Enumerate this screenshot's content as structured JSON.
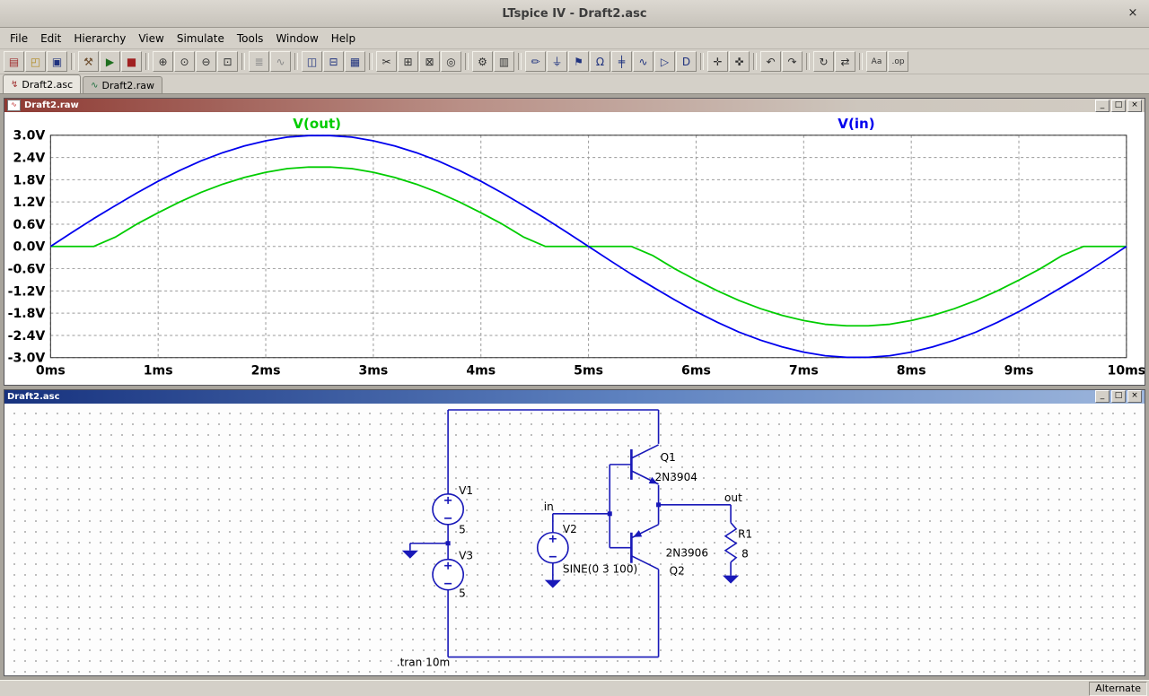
{
  "window": {
    "title": "LTspice IV - Draft2.asc",
    "close_glyph": "×"
  },
  "menu": {
    "items": [
      "File",
      "Edit",
      "Hierarchy",
      "View",
      "Simulate",
      "Tools",
      "Window",
      "Help"
    ]
  },
  "toolbar": {
    "icons": [
      {
        "name": "new-schematic",
        "glyph": "▤",
        "color": "#a03030"
      },
      {
        "name": "open-file",
        "glyph": "◰",
        "color": "#b08a20"
      },
      {
        "name": "save",
        "glyph": "▣",
        "color": "#20337f"
      },
      {
        "sep": true
      },
      {
        "name": "control-panel",
        "glyph": "⚒",
        "color": "#6b4a2a"
      },
      {
        "name": "run-simulation",
        "glyph": "▶",
        "color": "#1f6f1f"
      },
      {
        "name": "halt-simulation",
        "glyph": "■",
        "color": "#a02020"
      },
      {
        "sep": true
      },
      {
        "name": "zoom-in",
        "glyph": "⊕",
        "color": "#303030"
      },
      {
        "name": "zoom-back",
        "glyph": "⊙",
        "color": "#303030"
      },
      {
        "name": "zoom-out",
        "glyph": "⊖",
        "color": "#303030"
      },
      {
        "name": "zoom-full-extents",
        "glyph": "⊡",
        "color": "#303030"
      },
      {
        "sep": true
      },
      {
        "name": "spice-netlist",
        "glyph": "≣",
        "color": "#8a8a8a"
      },
      {
        "name": "visible-traces",
        "glyph": "∿",
        "color": "#8a8a8a"
      },
      {
        "sep": true
      },
      {
        "name": "tile-vertically",
        "glyph": "◫",
        "color": "#20337f"
      },
      {
        "name": "tile-horizontally",
        "glyph": "⊟",
        "color": "#20337f"
      },
      {
        "name": "cascade-windows",
        "glyph": "▦",
        "color": "#20337f"
      },
      {
        "sep": true
      },
      {
        "name": "cut",
        "glyph": "✂",
        "color": "#303030"
      },
      {
        "name": "copy",
        "glyph": "⊞",
        "color": "#303030"
      },
      {
        "name": "paste",
        "glyph": "⊠",
        "color": "#303030"
      },
      {
        "name": "find",
        "glyph": "◎",
        "color": "#303030"
      },
      {
        "sep": true
      },
      {
        "name": "print-setup",
        "glyph": "⚙",
        "color": "#303030"
      },
      {
        "name": "print",
        "glyph": "▥",
        "color": "#303030"
      },
      {
        "sep": true
      },
      {
        "name": "draw-wire",
        "glyph": "✏",
        "color": "#20337f"
      },
      {
        "name": "place-ground",
        "glyph": "⏚",
        "color": "#20337f"
      },
      {
        "name": "place-net-label",
        "glyph": "⚑",
        "color": "#20337f"
      },
      {
        "name": "place-resistor",
        "glyph": "Ω",
        "color": "#20337f"
      },
      {
        "name": "place-capacitor",
        "glyph": "╪",
        "color": "#20337f"
      },
      {
        "name": "place-inductor",
        "glyph": "∿",
        "color": "#20337f"
      },
      {
        "name": "place-diode",
        "glyph": "▷",
        "color": "#20337f"
      },
      {
        "name": "place-component",
        "glyph": "D",
        "color": "#20337f"
      },
      {
        "sep": true
      },
      {
        "name": "move",
        "glyph": "✛",
        "color": "#303030"
      },
      {
        "name": "drag",
        "glyph": "✜",
        "color": "#303030"
      },
      {
        "sep": true
      },
      {
        "name": "undo",
        "glyph": "↶",
        "color": "#303030"
      },
      {
        "name": "redo",
        "glyph": "↷",
        "color": "#303030"
      },
      {
        "sep": true
      },
      {
        "name": "rotate",
        "glyph": "↻",
        "color": "#303030"
      },
      {
        "name": "mirror",
        "glyph": "⇄",
        "color": "#303030"
      },
      {
        "sep": true
      },
      {
        "name": "add-text",
        "glyph": "Aa",
        "color": "#303030"
      },
      {
        "name": "spice-directive",
        "glyph": ".op",
        "color": "#303030"
      }
    ]
  },
  "tabs": [
    {
      "label": "Draft2.asc",
      "icon": "↯",
      "icon_color": "#a03030",
      "active": true
    },
    {
      "label": "Draft2.raw",
      "icon": "∿",
      "icon_color": "#207040",
      "active": false
    }
  ],
  "raw_window": {
    "title": "Draft2.raw",
    "icon": "∿",
    "minimize": "_",
    "maximize": "□",
    "close": "×"
  },
  "asc_window": {
    "title": "Draft2.asc",
    "minimize": "_",
    "maximize": "□",
    "close": "×"
  },
  "chart_data": {
    "type": "line",
    "title": "",
    "xlabel": "",
    "ylabel": "",
    "xlim": [
      0,
      10
    ],
    "ylim": [
      -3,
      3
    ],
    "grid": "dashed",
    "legend_position": "top-inside",
    "x_ticks": [
      "0ms",
      "1ms",
      "2ms",
      "3ms",
      "4ms",
      "5ms",
      "6ms",
      "7ms",
      "8ms",
      "9ms",
      "10ms"
    ],
    "y_ticks": [
      "3.0V",
      "2.4V",
      "1.8V",
      "1.2V",
      "0.6V",
      "0.0V",
      "-0.6V",
      "-1.2V",
      "-1.8V",
      "-2.4V",
      "-3.0V"
    ],
    "x": [
      0,
      0.2,
      0.4,
      0.6,
      0.8,
      1,
      1.2,
      1.4,
      1.6,
      1.8,
      2,
      2.2,
      2.4,
      2.6,
      2.8,
      3,
      3.2,
      3.4,
      3.6,
      3.8,
      4,
      4.2,
      4.4,
      4.6,
      4.8,
      5,
      5.2,
      5.4,
      5.6,
      5.8,
      6,
      6.2,
      6.4,
      6.6,
      6.8,
      7,
      7.2,
      7.4,
      7.6,
      7.8,
      8,
      8.2,
      8.4,
      8.6,
      8.8,
      9,
      9.2,
      9.4,
      9.6,
      9.8,
      10
    ],
    "series": [
      {
        "name": "V(out)",
        "color": "#00cc00",
        "values": [
          0,
          0,
          0,
          0.25,
          0.6,
          0.91,
          1.2,
          1.46,
          1.68,
          1.86,
          2,
          2.1,
          2.14,
          2.14,
          2.1,
          2,
          1.86,
          1.68,
          1.46,
          1.2,
          0.91,
          0.6,
          0.25,
          0,
          0,
          0,
          0,
          0,
          -0.25,
          -0.6,
          -0.91,
          -1.2,
          -1.46,
          -1.68,
          -1.86,
          -2,
          -2.1,
          -2.14,
          -2.14,
          -2.1,
          -2,
          -1.86,
          -1.68,
          -1.46,
          -1.2,
          -0.91,
          -0.6,
          -0.25,
          0,
          0,
          0
        ]
      },
      {
        "name": "V(in)",
        "color": "#0000ee",
        "values": [
          0,
          0.38,
          0.75,
          1.1,
          1.44,
          1.76,
          2.05,
          2.31,
          2.53,
          2.71,
          2.85,
          2.95,
          2.99,
          2.99,
          2.95,
          2.85,
          2.71,
          2.53,
          2.31,
          2.05,
          1.76,
          1.44,
          1.1,
          0.75,
          0.38,
          0,
          -0.38,
          -0.75,
          -1.1,
          -1.44,
          -1.76,
          -2.05,
          -2.31,
          -2.53,
          -2.71,
          -2.85,
          -2.95,
          -2.99,
          -2.99,
          -2.95,
          -2.85,
          -2.71,
          -2.53,
          -2.31,
          -2.05,
          -1.76,
          -1.44,
          -1.1,
          -0.75,
          -0.38,
          0
        ]
      }
    ]
  },
  "schematic": {
    "directive": ".tran 10m",
    "net_labels": {
      "in": "in",
      "out": "out"
    },
    "v1": {
      "ref": "V1",
      "value": "5"
    },
    "v3": {
      "ref": "V3",
      "value": "5"
    },
    "v2": {
      "ref": "V2",
      "value": "SINE(0 3 100)"
    },
    "q1": {
      "ref": "Q1",
      "value": "2N3904"
    },
    "q2": {
      "ref": "Q2",
      "value": "2N3906"
    },
    "r1": {
      "ref": "R1",
      "value": "8"
    }
  },
  "statusbar": {
    "mode": "Alternate"
  }
}
